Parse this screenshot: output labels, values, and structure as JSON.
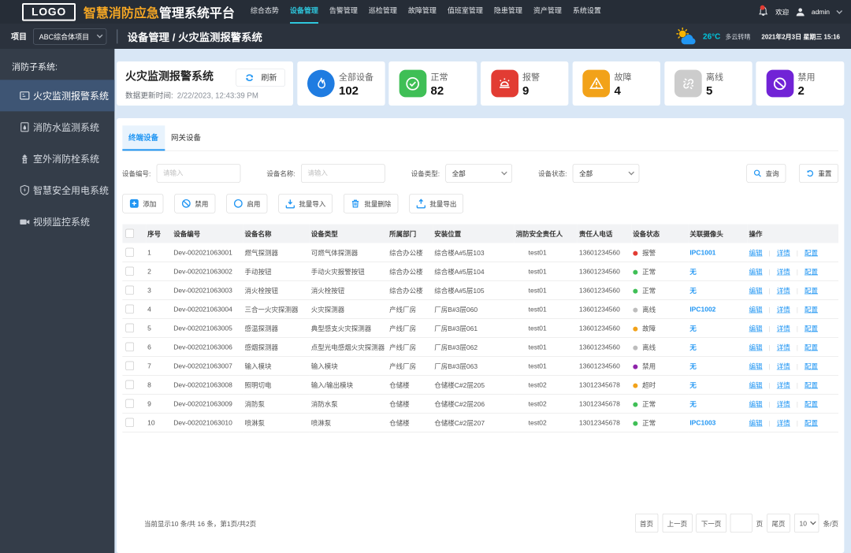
{
  "topbar": {
    "logo": "LOGO",
    "brand_highlight": "智慧消防应急",
    "brand_rest": "管理系统平台",
    "nav": [
      {
        "label": "综合态势",
        "active": false
      },
      {
        "label": "设备管理",
        "active": true
      },
      {
        "label": "告警管理",
        "active": false
      },
      {
        "label": "巡检管理",
        "active": false
      },
      {
        "label": "故障管理",
        "active": false
      },
      {
        "label": "值班室管理",
        "active": false
      },
      {
        "label": "隐患管理",
        "active": false
      },
      {
        "label": "资产管理",
        "active": false
      },
      {
        "label": "系统设置",
        "active": false
      }
    ],
    "welcome": "欢迎",
    "username": "admin"
  },
  "subbar": {
    "project_label": "项目",
    "project_value": "ABC综合体项目",
    "breadcrumb": "设备管理 / 火灾监测报警系统",
    "weather_temp": "26°C",
    "weather_desc": "多云转晴",
    "datetime": "2021年2月3日 星期三 15:16"
  },
  "sidebar": {
    "title": "消防子系统:",
    "items": [
      {
        "label": "火灾监测报警系统",
        "icon": "fire-alarm-monitor-icon",
        "active": true
      },
      {
        "label": "消防水监测系统",
        "icon": "water-monitor-icon",
        "active": false
      },
      {
        "label": "室外消防栓系统",
        "icon": "hydrant-icon",
        "active": false
      },
      {
        "label": "智慧安全用电系统",
        "icon": "electric-safety-icon",
        "active": false
      },
      {
        "label": "视频监控系统",
        "icon": "video-camera-icon",
        "active": false
      }
    ]
  },
  "overview": {
    "title": "火灾监测报警系统",
    "update_label": "数据更新时间:",
    "update_time": "2/22/2023, 12:43:39 PM",
    "refresh_label": "刷新",
    "stats": [
      {
        "label": "全部设备",
        "value": "102",
        "color": "#1f7ce1",
        "shape": "round",
        "icon": "flame-icon"
      },
      {
        "label": "正常",
        "value": "82",
        "color": "#3fbf56",
        "shape": "square",
        "icon": "check-circle-icon"
      },
      {
        "label": "报警",
        "value": "9",
        "color": "#e23c33",
        "shape": "square",
        "icon": "alarm-siren-icon"
      },
      {
        "label": "故障",
        "value": "4",
        "color": "#f2a219",
        "shape": "square",
        "icon": "warning-triangle-icon"
      },
      {
        "label": "离线",
        "value": "5",
        "color": "#cccccc",
        "shape": "square",
        "icon": "offline-link-icon"
      },
      {
        "label": "禁用",
        "value": "2",
        "color": "#7123d6",
        "shape": "square",
        "icon": "ban-icon"
      }
    ]
  },
  "tabs": [
    {
      "label": "终端设备",
      "active": true
    },
    {
      "label": "网关设备",
      "active": false
    }
  ],
  "filters": {
    "device_no_label": "设备编号:",
    "device_no_placeholder": "请输入",
    "device_name_label": "设备名称:",
    "device_name_placeholder": "请输入",
    "device_type_label": "设备类型:",
    "device_type_value": "全部",
    "device_status_label": "设备状态:",
    "device_status_value": "全部",
    "search_label": "查询",
    "reset_label": "重置"
  },
  "actions": [
    {
      "label": "添加",
      "icon": "plus-icon"
    },
    {
      "label": "禁用",
      "icon": "ban-icon"
    },
    {
      "label": "启用",
      "icon": "enable-icon"
    },
    {
      "label": "批量导入",
      "icon": "import-icon"
    },
    {
      "label": "批量删除",
      "icon": "delete-icon"
    },
    {
      "label": "批量导出",
      "icon": "export-icon"
    }
  ],
  "table": {
    "columns": [
      "序号",
      "设备编号",
      "设备名称",
      "设备类型",
      "所属部门",
      "安装位置",
      "消防安全责任人",
      "责任人电话",
      "设备状态",
      "关联摄像头",
      "操作"
    ],
    "op_labels": [
      "编辑",
      "详情",
      "配置"
    ],
    "status_colors": {
      "报警": "#e23c33",
      "正常": "#3fbf56",
      "离线": "#bdbdbd",
      "故障": "#f2a219",
      "禁用": "#8e24aa",
      "超时": "#f2a219"
    },
    "rows": [
      {
        "no": "1",
        "code": "Dev-002021063001",
        "name": "燃气探测器",
        "type": "可燃气体探测器",
        "dept": "综合办公楼",
        "location": "综合楼A#5层103",
        "owner": "test01",
        "phone": "13601234560",
        "status": "报警",
        "camera": "IPC1001"
      },
      {
        "no": "2",
        "code": "Dev-002021063002",
        "name": "手动按钮",
        "type": "手动火灾报警按钮",
        "dept": "综合办公楼",
        "location": "综合楼A#5层104",
        "owner": "test01",
        "phone": "13601234560",
        "status": "正常",
        "camera": "无"
      },
      {
        "no": "3",
        "code": "Dev-002021063003",
        "name": "消火栓按钮",
        "type": "消火栓按钮",
        "dept": "综合办公楼",
        "location": "综合楼A#5层105",
        "owner": "test01",
        "phone": "13601234560",
        "status": "正常",
        "camera": "无"
      },
      {
        "no": "4",
        "code": "Dev-002021063004",
        "name": "三合一火灾探测器",
        "type": "火灾探测器",
        "dept": "产线厂房",
        "location": "厂房B#3层060",
        "owner": "test01",
        "phone": "13601234560",
        "status": "离线",
        "camera": "IPC1002"
      },
      {
        "no": "5",
        "code": "Dev-002021063005",
        "name": "感温探测器",
        "type": "典型感支火灾探测器",
        "dept": "产线厂房",
        "location": "厂房B#3层061",
        "owner": "test01",
        "phone": "13601234560",
        "status": "故障",
        "camera": "无"
      },
      {
        "no": "6",
        "code": "Dev-002021063006",
        "name": "感烟探测器",
        "type": "点型光电感烟火灾探测器",
        "dept": "产线厂房",
        "location": "厂房B#3层062",
        "owner": "test01",
        "phone": "13601234560",
        "status": "离线",
        "camera": "无"
      },
      {
        "no": "7",
        "code": "Dev-002021063007",
        "name": "输入模块",
        "type": "输入模块",
        "dept": "产线厂房",
        "location": "厂房B#3层063",
        "owner": "test01",
        "phone": "13601234560",
        "status": "禁用",
        "camera": "无"
      },
      {
        "no": "8",
        "code": "Dev-002021063008",
        "name": "照明切电",
        "type": "输入/输出模块",
        "dept": "仓储楼",
        "location": "仓储楼C#2层205",
        "owner": "test02",
        "phone": "13012345678",
        "status": "超时",
        "camera": "无"
      },
      {
        "no": "9",
        "code": "Dev-002021063009",
        "name": "消防泵",
        "type": "消防水泵",
        "dept": "仓储楼",
        "location": "仓储楼C#2层206",
        "owner": "test02",
        "phone": "13012345678",
        "status": "正常",
        "camera": "无"
      },
      {
        "no": "10",
        "code": "Dev-002021063010",
        "name": "喷淋泵",
        "type": "喷淋泵",
        "dept": "仓储楼",
        "location": "仓储楼C#2层207",
        "owner": "test02",
        "phone": "13012345678",
        "status": "正常",
        "camera": "IPC1003"
      }
    ]
  },
  "pagination": {
    "summary": "当前显示10 条/共 16 条，第1页/共2页",
    "first": "首页",
    "prev": "上一页",
    "next": "下一页",
    "page_unit": "页",
    "last": "尾页",
    "page_size": "10",
    "size_unit": "条/页"
  }
}
